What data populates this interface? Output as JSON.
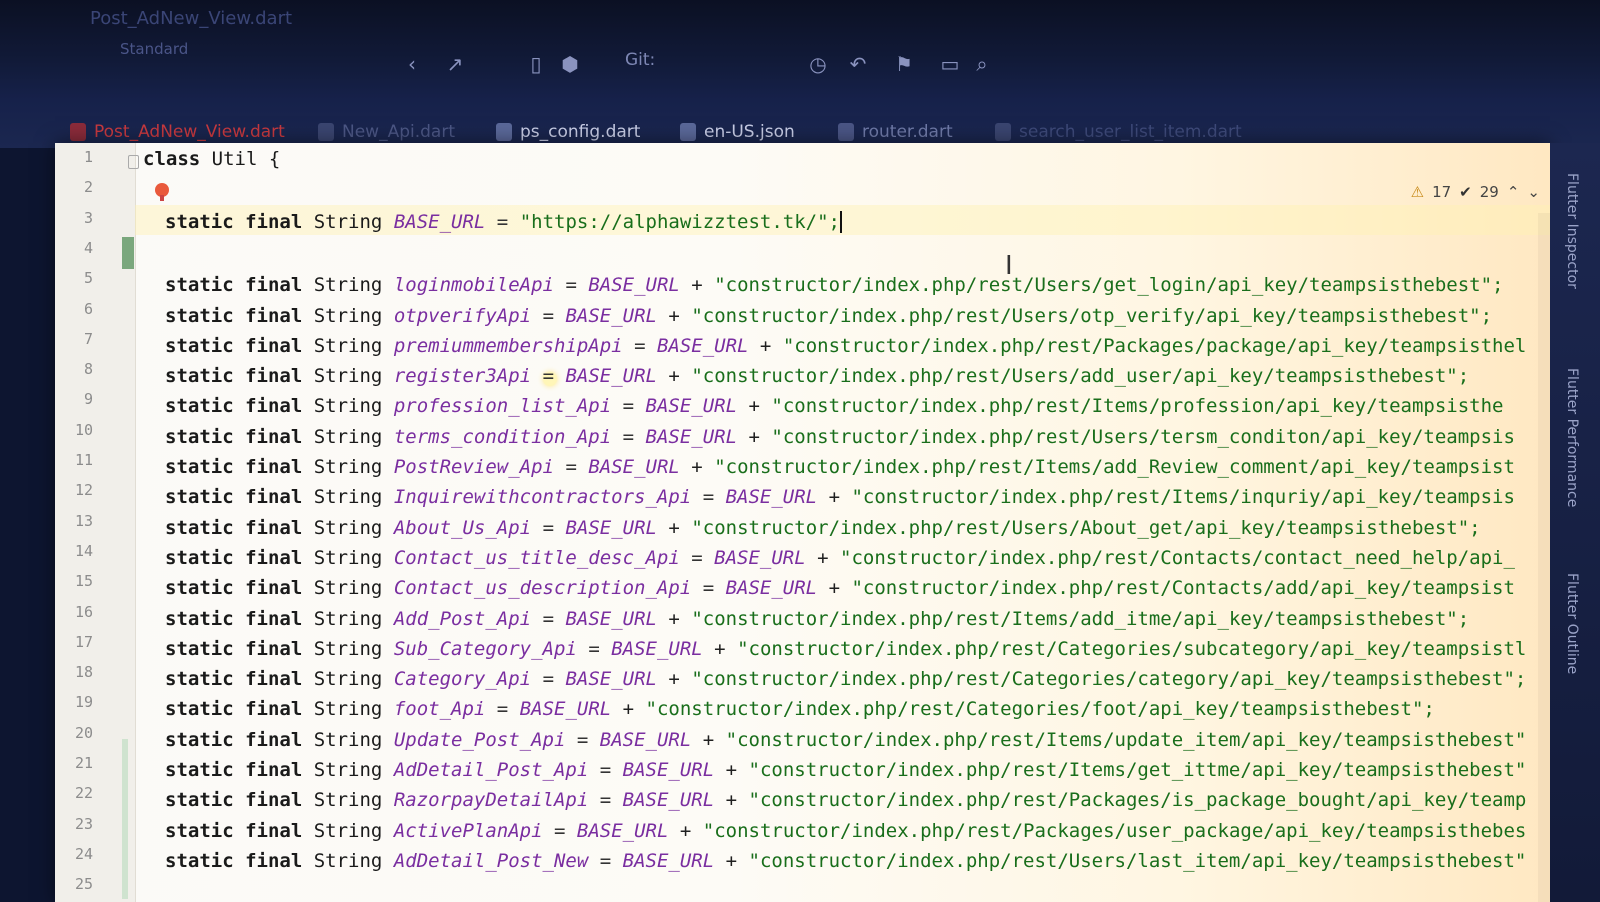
{
  "window": {
    "title": "Post_AdNew_View.dart",
    "branch": "Standard"
  },
  "toolbar": {
    "git_label": "Git:"
  },
  "tabs": [
    {
      "label": "Post_AdNew_View.dart",
      "active": true,
      "color": "#d44a4a"
    },
    {
      "label": "New_Api.dart",
      "active": false,
      "color": "#5f6b99"
    },
    {
      "label": "ps_config.dart",
      "active": false,
      "color": "#c8cde6"
    },
    {
      "label": "en-US.json",
      "active": false,
      "color": "#c8cde6"
    },
    {
      "label": "router.dart",
      "active": false,
      "color": "#6f7aa8"
    },
    {
      "label": "search_user_list_item.dart",
      "active": false,
      "color": "#4f5a88"
    }
  ],
  "status": {
    "warnings": "17",
    "weak_warnings": "29"
  },
  "right_panels": [
    "Flutter Inspector",
    "Flutter Performance",
    "Flutter Outline"
  ],
  "code": {
    "line_numbers": [
      "1",
      "2",
      "3",
      "4",
      "5",
      "6",
      "7",
      "8",
      "9",
      "10",
      "11",
      "12",
      "13",
      "14",
      "15",
      "16",
      "17",
      "18",
      "19",
      "20",
      "21",
      "22",
      "23",
      "24",
      "25"
    ],
    "line1": {
      "kw": "class",
      "name": "Util {"
    },
    "base": {
      "kw": "static final",
      "type": "String",
      "name": "BASE_URL",
      "eq": "=",
      "value": "\"https://alphawizztest.tk/\";"
    },
    "rows": [
      {
        "name": "loginmobileApi",
        "ref": "BASE_URL",
        "value": "\"constructor/index.php/rest/Users/get_login/api_key/teampsisthebest\";"
      },
      {
        "name": "otpverifyApi",
        "ref": "BASE_URL",
        "value": "\"constructor/index.php/rest/Users/otp_verify/api_key/teampsisthebest\";"
      },
      {
        "name": "premiummembershipApi",
        "ref": "BASE_URL",
        "value": "\"constructor/index.php/rest/Packages/package/api_key/teampsisthel"
      },
      {
        "name": "register3Api",
        "ref": "BASE_URL",
        "value": "\"constructor/index.php/rest/Users/add_user/api_key/teampsisthebest\";"
      },
      {
        "name": "profession_list_Api",
        "ref": "BASE_URL",
        "value": "\"constructor/index.php/rest/Items/profession/api_key/teampsisthe"
      },
      {
        "name": "terms_condition_Api",
        "ref": "BASE_URL",
        "value": "\"constructor/index.php/rest/Users/tersm_conditon/api_key/teampsis"
      },
      {
        "name": "PostReview_Api",
        "ref": "BASE_URL",
        "value": "\"constructor/index.php/rest/Items/add_Review_comment/api_key/teampsist"
      },
      {
        "name": "Inquirewithcontractors_Api",
        "ref": "BASE_URL",
        "value": "\"constructor/index.php/rest/Items/inquriy/api_key/teampsis"
      },
      {
        "name": "About_Us_Api",
        "ref": "BASE_URL",
        "value": "\"constructor/index.php/rest/Users/About_get/api_key/teampsisthebest\";"
      },
      {
        "name": "Contact_us_title_desc_Api",
        "ref": "BASE_URL",
        "value": "\"constructor/index.php/rest/Contacts/contact_need_help/api_"
      },
      {
        "name": "Contact_us_description_Api",
        "ref": "BASE_URL",
        "value": "\"constructor/index.php/rest/Contacts/add/api_key/teampsist"
      },
      {
        "name": "Add_Post_Api",
        "ref": "BASE_URL",
        "value": "\"constructor/index.php/rest/Items/add_itme/api_key/teampsisthebest\";"
      },
      {
        "name": "Sub_Category_Api",
        "ref": "BASE_URL",
        "value": "\"constructor/index.php/rest/Categories/subcategory/api_key/teampsistl"
      },
      {
        "name": "Category_Api",
        "ref": "BASE_URL",
        "value": "\"constructor/index.php/rest/Categories/category/api_key/teampsisthebest\";"
      },
      {
        "name": "foot_Api",
        "ref": "BASE_URL",
        "value": "\"constructor/index.php/rest/Categories/foot/api_key/teampsisthebest\";"
      },
      {
        "name": "Update_Post_Api",
        "ref": "BASE_URL",
        "value": "\"constructor/index.php/rest/Items/update_item/api_key/teampsisthebest\""
      },
      {
        "name": "AdDetail_Post_Api",
        "ref": "BASE_URL",
        "value": "\"constructor/index.php/rest/Items/get_ittme/api_key/teampsisthebest\""
      },
      {
        "name": "RazorpayDetailApi",
        "ref": "BASE_URL",
        "value": "\"constructor/index.php/rest/Packages/is_package_bought/api_key/teamp"
      },
      {
        "name": "ActivePlanApi",
        "ref": "BASE_URL",
        "value": "\"constructor/index.php/rest/Packages/user_package/api_key/teampsisthebes"
      },
      {
        "name": "AdDetail_Post_New",
        "ref": "BASE_URL",
        "value": "\"constructor/index.php/rest/Users/last_item/api_key/teampsisthebest\""
      }
    ]
  }
}
